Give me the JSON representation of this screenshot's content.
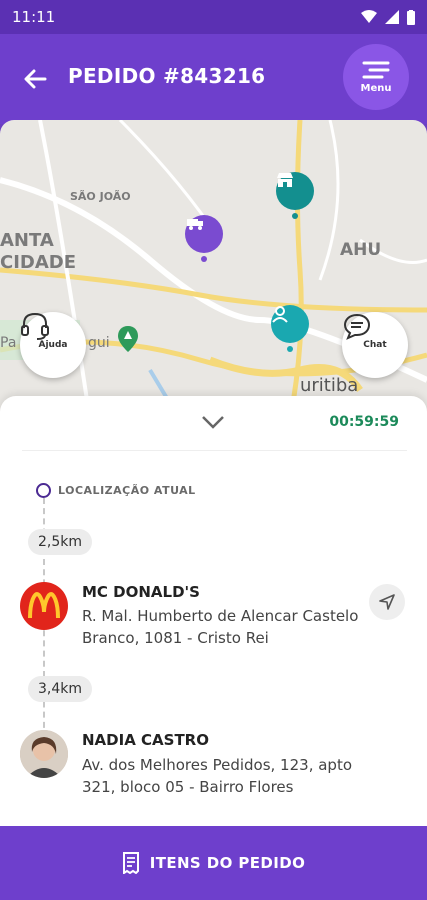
{
  "status_bar": {
    "time": "11:11"
  },
  "header": {
    "title": "PEDIDO #843216",
    "menu_label": "Menu"
  },
  "map": {
    "labels": [
      "SÃO JOÃO",
      "ANTA",
      "CIDADE",
      "AHU",
      "Pa",
      "gui",
      "uritiba"
    ],
    "help_label": "Ajuda",
    "chat_label": "Chat"
  },
  "sheet": {
    "timer": "00:59:59",
    "current_location_label": "LOCALIZAÇÃO ATUAL",
    "stops": [
      {
        "distance": "2,5km",
        "name": "MC DONALD'S",
        "address": "R. Mal. Humberto de Alencar Castelo Branco, 1081 - Cristo Rei"
      },
      {
        "distance": "3,4km",
        "name": "NADIA CASTRO",
        "address": "Av. dos Melhores Pedidos, 123, apto 321, bloco 05 - Bairro Flores"
      }
    ]
  },
  "footer": {
    "label": "ITENS DO PEDIDO"
  },
  "colors": {
    "primary": "#6e3fcc",
    "timer": "#1c8a5a",
    "pin_store": "#138f8f",
    "pin_courier": "#7a4bd0",
    "pin_customer": "#1aa8b0"
  }
}
